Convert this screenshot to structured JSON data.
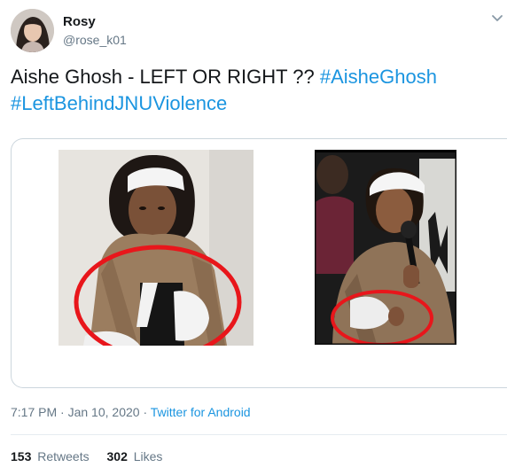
{
  "author": {
    "display_name": "Rosy",
    "handle": "@rose_k01",
    "avatar_icon": "profile-photo"
  },
  "tweet": {
    "text_plain": "Aishe Ghosh - LEFT OR RIGHT ?? ",
    "hashtag_1": "#AisheGhosh",
    "hashtag_2": "#LeftBehindJNUViolence"
  },
  "media": {
    "left_photo": "photo-bandaged-left-arm",
    "right_photo": "photo-bandaged-right-arm-with-microphone",
    "annotation_color": "#e8161b"
  },
  "meta": {
    "time": "7:17 PM",
    "date": "Jan 10, 2020",
    "separator": "·",
    "source": "Twitter for Android"
  },
  "stats": {
    "retweets_count": "153",
    "retweets_label": "Retweets",
    "likes_count": "302",
    "likes_label": "Likes"
  },
  "colors": {
    "text": "#14171a",
    "secondary": "#657786",
    "link": "#1b95e0",
    "border": "#ccd6dd"
  }
}
